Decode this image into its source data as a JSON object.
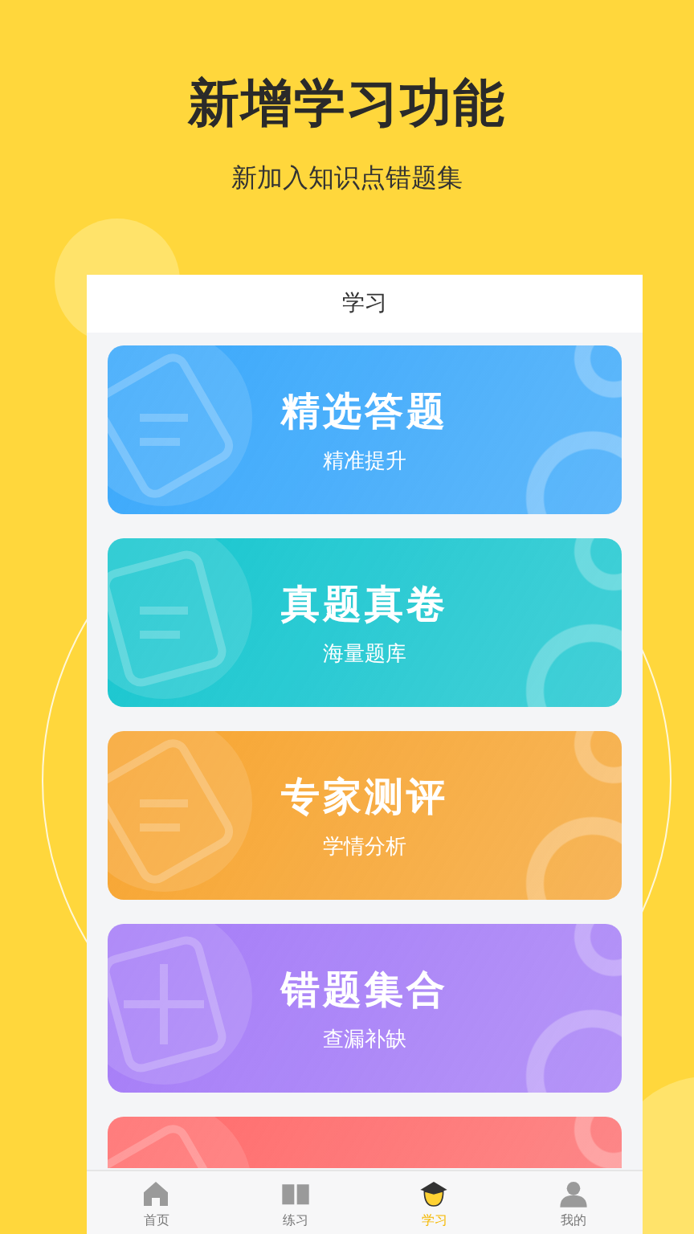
{
  "headline": "新增学习功能",
  "subheadline": "新加入知识点错题集",
  "screen_title": "学习",
  "cards": [
    {
      "title": "精选答题",
      "subtitle": "精准提升",
      "color": "#3aa8fb"
    },
    {
      "title": "真题真卷",
      "subtitle": "海量题库",
      "color": "#17c6cf"
    },
    {
      "title": "专家测评",
      "subtitle": "学情分析",
      "color": "#f7a531"
    },
    {
      "title": "错题集合",
      "subtitle": "查漏补缺",
      "color": "#a57cf7"
    },
    {
      "color": "#ff6b6b"
    }
  ],
  "tabs": [
    {
      "label": "首页",
      "selected": false
    },
    {
      "label": "练习",
      "selected": false
    },
    {
      "label": "学习",
      "selected": true
    },
    {
      "label": "我的",
      "selected": false
    }
  ]
}
